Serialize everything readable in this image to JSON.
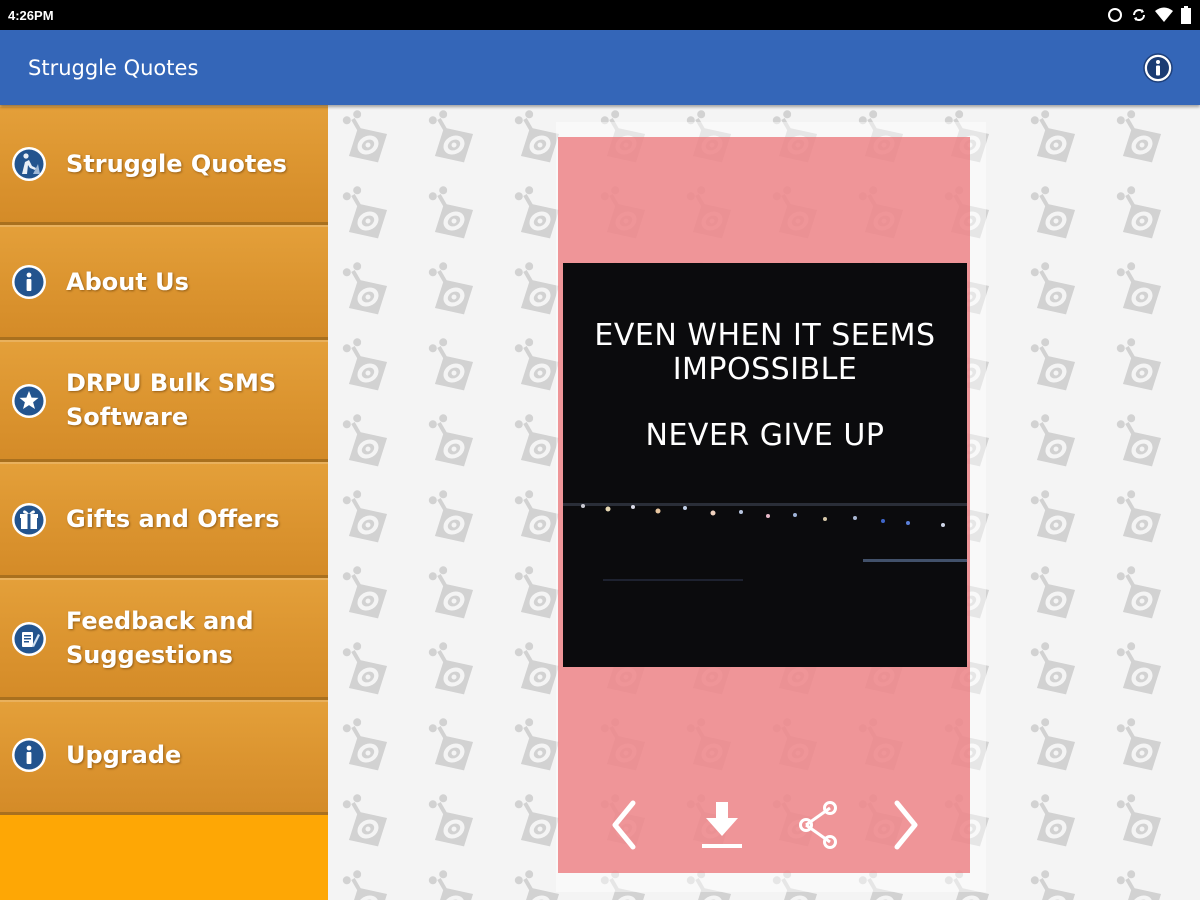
{
  "status_bar": {
    "time": "4:26PM",
    "icons": [
      "sync-icon",
      "data-sync-icon",
      "wifi-icon",
      "battery-icon"
    ]
  },
  "app_bar": {
    "title": "Struggle Quotes",
    "info_icon": "info-icon"
  },
  "sidebar": {
    "items": [
      {
        "label": "Struggle Quotes",
        "icon": "climber-icon"
      },
      {
        "label": "About Us",
        "icon": "info-icon"
      },
      {
        "label": "DRPU Bulk SMS Software",
        "icon": "star-icon"
      },
      {
        "label": "Gifts and Offers",
        "icon": "gift-icon"
      },
      {
        "label": "Feedback and Suggestions",
        "icon": "feedback-icon"
      },
      {
        "label": "Upgrade",
        "icon": "info-icon"
      }
    ]
  },
  "quote": {
    "line1": "EVEN WHEN IT SEEMS",
    "line2": "IMPOSSIBLE",
    "line3": "NEVER GIVE UP"
  },
  "card_actions": [
    "previous-icon",
    "download-icon",
    "share-icon",
    "next-icon"
  ],
  "colors": {
    "app_bar": "#3466b8",
    "sidebar_item": "#dc9530",
    "sidebar_bg": "#fea705",
    "card": "#ec787c",
    "quote_bg": "#0b0b0d"
  }
}
